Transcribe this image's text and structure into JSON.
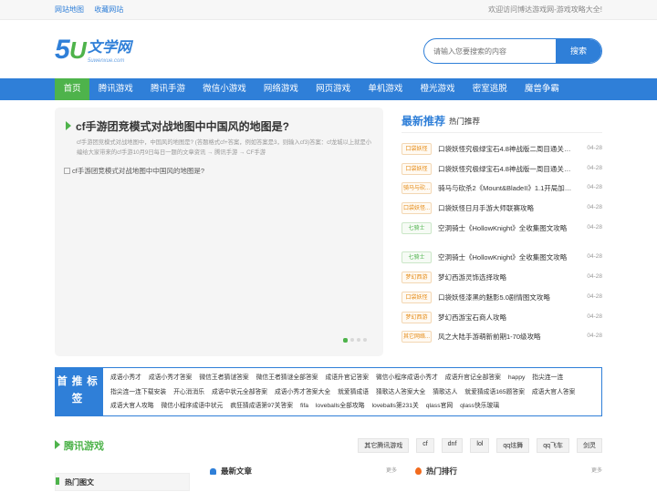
{
  "topbar": {
    "links": [
      "网站地图",
      "收藏网站"
    ],
    "welcome": "欢迎访问博达游戏网-游戏攻略大全!"
  },
  "header": {
    "logo_text": "文学网",
    "logo_number": "5U",
    "logo_sub": "5uwenxue.com",
    "search_placeholder": "请输入您要搜索的内容",
    "search_button": "搜索"
  },
  "nav": [
    "首页",
    "腾讯游戏",
    "腾讯手游",
    "微信小游戏",
    "网络游戏",
    "网页游戏",
    "单机游戏",
    "橙光游戏",
    "密室逃脱",
    "魔兽争霸"
  ],
  "feature": {
    "title": "cf手游团竞模式对战地图中中国风的地图是?",
    "desc": "cf手游团竞模式对战地图中，中国风的地图是? (答题格式cf+答案，例如答案是3，则输入cf3)答案：cf龙城以上就是小编给大家带来的cf手游10月9日每日一题的文章资讯 → 腾讯手游 → CF手游",
    "image_alt": "cf手游团竞模式对战地图中中国风的地图是?"
  },
  "news": {
    "title": "最新推荐",
    "subtitle": "热门推荐",
    "items": [
      {
        "tag": "口袋妖怪",
        "tag_color": "orange",
        "text": "口袋妖怪究极绿宝石4.8神战版二周目通关攻略",
        "date": "04-28"
      },
      {
        "tag": "口袋妖怪",
        "tag_color": "orange",
        "text": "口袋妖怪究极绿宝石4.8神战版一周目通关攻略",
        "date": "04-28"
      },
      {
        "tag": "骑马与砍...",
        "tag_color": "orange",
        "text": "骑马与砍杀2《Mount&BladeII》1.1开局加点攻略",
        "date": "04-28"
      },
      {
        "tag": "口袋妖怪...",
        "tag_color": "orange",
        "text": "口袋妖怪日月手游大师联赛攻略",
        "date": "04-28"
      },
      {
        "tag": "七骑士",
        "tag_color": "green",
        "text": "空洞骑士《HollowKnight》全收集图文攻略",
        "date": "04-28"
      },
      {
        "tag": "七骑士",
        "tag_color": "green",
        "text": "空洞骑士《HollowKnight》全收集图文攻略",
        "date": "04-28"
      },
      {
        "tag": "梦幻西游",
        "tag_color": "orange",
        "text": "梦幻西游灵饰选择攻略",
        "date": "04-28"
      },
      {
        "tag": "口袋妖怪",
        "tag_color": "orange",
        "text": "口袋妖怪漆黑的魅影5.0剧情图文攻略",
        "date": "04-28"
      },
      {
        "tag": "梦幻西游",
        "tag_color": "orange",
        "text": "梦幻西游宝石商人攻略",
        "date": "04-28"
      },
      {
        "tag": "其它网络...",
        "tag_color": "orange",
        "text": "风之大陆手游萌新前期1-70级攻略",
        "date": "04-28"
      }
    ]
  },
  "tags": {
    "label": "首推标签",
    "words": [
      "成语小秀才",
      "成语小秀才答案",
      "微信王者猜谜答案",
      "微信王者猜谜全部答案",
      "成语升官记答案",
      "微信小程序成语小秀才",
      "成语升官记全部答案",
      "happy",
      "指尖连一连",
      "指尖连一连下载安装",
      "开心消消乐",
      "成语中状元全部答案",
      "成语小秀才答案大全",
      "就爱猜成语",
      "猜歌达人答案大全",
      "猜歌达人",
      "就爱猜成语165题答案",
      "成语大官人答案",
      "成语大官人攻略",
      "微信小程序成语中状元",
      "疯狂猜成语第97关答案",
      "fifa",
      "loveballs全部攻略",
      "loveballs第231关",
      "qlass官网",
      "qlass快乐玻璃"
    ]
  },
  "section": {
    "title": "腾讯游戏",
    "tags": [
      "其它腾讯游戏",
      "cf",
      "dnf",
      "lol",
      "qq炫舞",
      "qq飞车",
      "剑灵"
    ]
  },
  "bottom": {
    "hot_label": "热门图文",
    "latest": "最新文章",
    "ranking": "热门排行",
    "more": "更多"
  }
}
